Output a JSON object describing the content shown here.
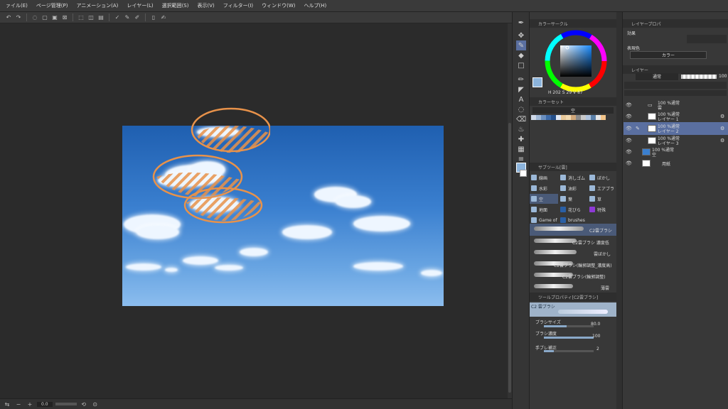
{
  "menu": {
    "items": [
      "ァイル(E)",
      "ページ管理(P)",
      "アニメーション(A)",
      "レイヤー(L)",
      "選択範囲(S)",
      "表示(V)",
      "フィルター(I)",
      "ウィンドウ(W)",
      "ヘルプ(H)"
    ]
  },
  "status": {
    "zoom": "0.0"
  },
  "color_wheel": {
    "title": "カラーサークル",
    "h": "202",
    "s": "29",
    "v": "87"
  },
  "color_set": {
    "title": "カラーセット",
    "set_name": "空"
  },
  "sub_tool": {
    "title": "サブツール[雲]",
    "items": [
      {
        "label": "線画",
        "icon": "brush-icon"
      },
      {
        "label": "消しゴム",
        "icon": "eraser-icon"
      },
      {
        "label": "ぼかし",
        "icon": "blur-icon"
      },
      {
        "label": "水彩",
        "icon": "watercolor-icon"
      },
      {
        "label": "油彩",
        "icon": "oil-icon"
      },
      {
        "label": "エアブラ",
        "icon": "airbrush-icon"
      },
      {
        "label": "空",
        "icon": "sky-icon"
      },
      {
        "label": "葉",
        "icon": "leaf-icon"
      },
      {
        "label": "草",
        "icon": "grass-icon"
      },
      {
        "label": "地面",
        "icon": "ground-icon"
      },
      {
        "label": "花びら",
        "icon": "petal-icon"
      },
      {
        "label": "特殊",
        "icon": "special-icon"
      },
      {
        "label": "Game of",
        "icon": "game-icon"
      },
      {
        "label": "brushes",
        "icon": "brushes-icon"
      }
    ],
    "brushes": [
      "C2雲ブラシ",
      "C2雲ブラシ 濃度低",
      "雲ぼかし",
      "C2雲ブラシ(輪郭調整_濃度高)",
      "C2雲ブラシ(輪郭調整)",
      "薄雲"
    ]
  },
  "tool_property": {
    "title": "ツールプロパティ[C2雲ブラシ]",
    "preview_label": "C2 雲ブラシ",
    "brush_size_label": "ブラシサイズ",
    "brush_size_value": "80.0",
    "brush_density_label": "ブラシ濃度",
    "brush_density_value": "100",
    "stabilization_label": "手ブレ補正",
    "stabilization_value": "2",
    "brush_size_fraction": 0.45,
    "brush_density_fraction": 1.0,
    "stabilization_fraction": 0.2
  },
  "layer_property": {
    "title": "レイヤープロパ",
    "tab2": "",
    "effect_label": "効果",
    "expression_color_label": "表現色",
    "expression_color_value": "カラー"
  },
  "layers_panel": {
    "title": "レイヤー",
    "tab2": "",
    "blend_mode": "通常",
    "opacity": "100",
    "layers": [
      {
        "name": "100 %通常",
        "sub": "雲",
        "type": "folder"
      },
      {
        "name": "100 %通常",
        "sub": "レイヤー 1",
        "type": "layer"
      },
      {
        "name": "100 %通常",
        "sub": "レイヤー 2",
        "type": "layer"
      },
      {
        "name": "100 %通常",
        "sub": "レイヤー 3",
        "type": "layer"
      },
      {
        "name": "100 %通常",
        "sub": "空",
        "type": "layer"
      },
      {
        "name": "用紙",
        "sub": "",
        "type": "paper"
      }
    ]
  },
  "colors": {
    "accent": "#5a6fa0",
    "sky_top": "#1f5fb0",
    "sky_bottom": "#8cbdee",
    "annotation": "#e8924a"
  }
}
